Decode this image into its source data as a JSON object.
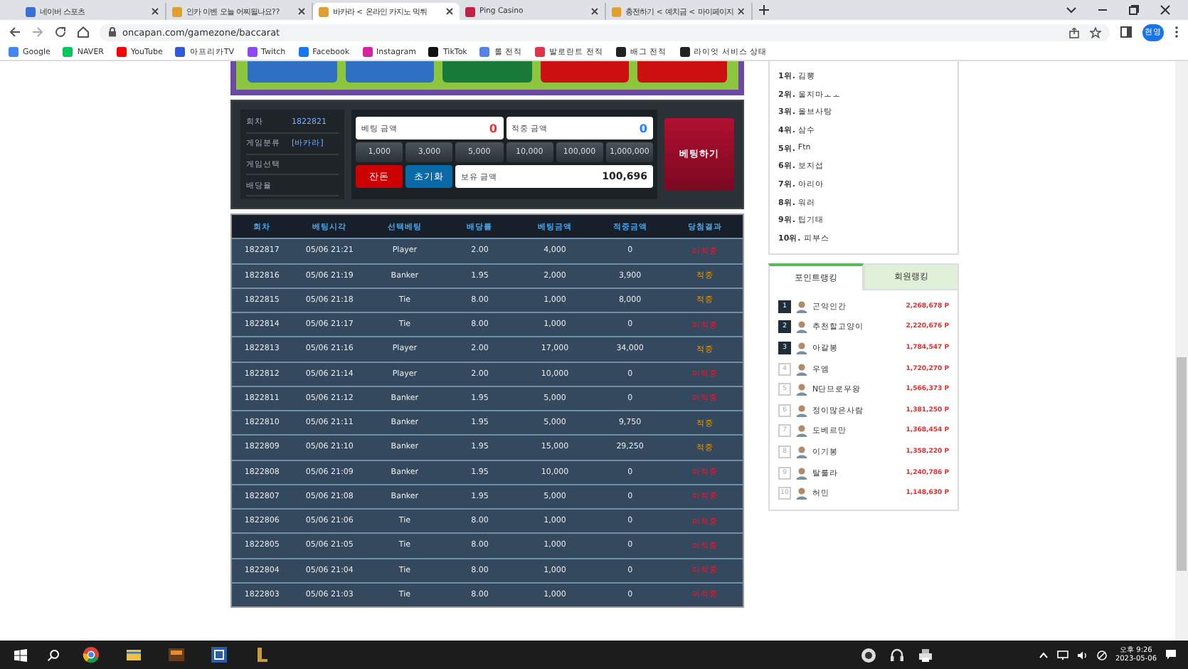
{
  "browser": {
    "tabs": [
      {
        "title": "네이버 스포츠",
        "selected": false,
        "color": "#3b6fd8"
      },
      {
        "title": "인카 이벤 오늘 어찌될나요??",
        "selected": false,
        "color": "#e0a030"
      },
      {
        "title": "바카라 < 온라인 카지노 먹튀",
        "selected": true,
        "color": "#e0a030"
      },
      {
        "title": "Ping Casino",
        "selected": false,
        "color": "#c0224a"
      },
      {
        "title": "충전하기 < 예치금 < 마이페이지",
        "selected": false,
        "color": "#e0a030"
      }
    ],
    "address": "oncapan.com/gamezone/baccarat",
    "profile": "현영",
    "bookmarks": [
      {
        "label": "Google",
        "color": "#4285f4"
      },
      {
        "label": "NAVER",
        "color": "#03c75a"
      },
      {
        "label": "YouTube",
        "color": "#ff0000"
      },
      {
        "label": "아프리카TV",
        "color": "#2f5bd8"
      },
      {
        "label": "Twitch",
        "color": "#9146ff"
      },
      {
        "label": "Facebook",
        "color": "#1877f2"
      },
      {
        "label": "Instagram",
        "color": "#d6249f"
      },
      {
        "label": "TikTok",
        "color": "#111111"
      },
      {
        "label": "롤 전적",
        "color": "#5383e8"
      },
      {
        "label": "발로란트 전적",
        "color": "#e0344a"
      },
      {
        "label": "배그 전적",
        "color": "#222222"
      },
      {
        "label": "라이엇 서비스 상태",
        "color": "#222222"
      }
    ]
  },
  "game_buttons": [
    {
      "color": "#2f6fc4"
    },
    {
      "color": "#2f6fc4"
    },
    {
      "color": "#1a7a3a"
    },
    {
      "color": "#cc1010"
    },
    {
      "color": "#cc1010"
    }
  ],
  "bet_panel": {
    "info": [
      {
        "label": "회차",
        "value": "1822821"
      },
      {
        "label": "게임분류",
        "value": "[바카라]"
      },
      {
        "label": "게임선택"
      },
      {
        "label": "배당율"
      }
    ],
    "bet_amount": {
      "label": "베팅 금액",
      "value": "0"
    },
    "win_amount": {
      "label": "적중 금액",
      "value": "0"
    },
    "chips": [
      "1,000",
      "3,000",
      "5,000",
      "10,000",
      "100,000",
      "1,000,000"
    ],
    "switch_button": "잔돈",
    "reset_button": "초기화",
    "balance": {
      "label": "보유 금액",
      "value": "100,696"
    },
    "bet_button": "베팅하기"
  },
  "history": {
    "columns": [
      "회차",
      "베팅시각",
      "선택베팅",
      "배당률",
      "베팅금액",
      "적중금액",
      "당첨결과"
    ],
    "rows": [
      {
        "cells": [
          "1822817",
          "05/06 21:21",
          "Player",
          "2.00",
          "4,000",
          "0"
        ],
        "result": "미적중",
        "kind": "miss"
      },
      {
        "cells": [
          "1822816",
          "05/06 21:19",
          "Banker",
          "1.95",
          "2,000",
          "3,900"
        ],
        "result": "적중",
        "kind": "hit"
      },
      {
        "cells": [
          "1822815",
          "05/06 21:18",
          "Tie",
          "8.00",
          "1,000",
          "8,000"
        ],
        "result": "적중",
        "kind": "hit"
      },
      {
        "cells": [
          "1822814",
          "05/06 21:17",
          "Tie",
          "8.00",
          "1,000",
          "0"
        ],
        "result": "미적중",
        "kind": "miss"
      },
      {
        "cells": [
          "1822813",
          "05/06 21:16",
          "Player",
          "2.00",
          "17,000",
          "34,000"
        ],
        "result": "적중",
        "kind": "hit"
      },
      {
        "cells": [
          "1822812",
          "05/06 21:14",
          "Player",
          "2.00",
          "10,000",
          "0"
        ],
        "result": "미적중",
        "kind": "miss"
      },
      {
        "cells": [
          "1822811",
          "05/06 21:12",
          "Banker",
          "1.95",
          "5,000",
          "0"
        ],
        "result": "미적중",
        "kind": "miss"
      },
      {
        "cells": [
          "1822810",
          "05/06 21:11",
          "Banker",
          "1.95",
          "5,000",
          "9,750"
        ],
        "result": "적중",
        "kind": "hit"
      },
      {
        "cells": [
          "1822809",
          "05/06 21:10",
          "Banker",
          "1.95",
          "15,000",
          "29,250"
        ],
        "result": "적중",
        "kind": "hit"
      },
      {
        "cells": [
          "1822808",
          "05/06 21:09",
          "Banker",
          "1.95",
          "10,000",
          "0"
        ],
        "result": "미적중",
        "kind": "miss"
      },
      {
        "cells": [
          "1822807",
          "05/06 21:08",
          "Banker",
          "1.95",
          "5,000",
          "0"
        ],
        "result": "미적중",
        "kind": "miss"
      },
      {
        "cells": [
          "1822806",
          "05/06 21:06",
          "Tie",
          "8.00",
          "1,000",
          "0"
        ],
        "result": "미적중",
        "kind": "miss"
      },
      {
        "cells": [
          "1822805",
          "05/06 21:05",
          "Tie",
          "8.00",
          "1,000",
          "0"
        ],
        "result": "미적중",
        "kind": "miss"
      },
      {
        "cells": [
          "1822804",
          "05/06 21:04",
          "Tie",
          "8.00",
          "1,000",
          "0"
        ],
        "result": "미적중",
        "kind": "miss"
      },
      {
        "cells": [
          "1822803",
          "05/06 21:03",
          "Tie",
          "8.00",
          "1,000",
          "0"
        ],
        "result": "미적중",
        "kind": "miss"
      }
    ]
  },
  "top_ranking": [
    {
      "rank": "1위.",
      "name": "김뽕"
    },
    {
      "rank": "2위.",
      "name": "울지마ㅗㅗ"
    },
    {
      "rank": "3위.",
      "name": "올브사탕"
    },
    {
      "rank": "4위.",
      "name": "삼수"
    },
    {
      "rank": "5위.",
      "name": "Ftn"
    },
    {
      "rank": "6위.",
      "name": "보지섭"
    },
    {
      "rank": "7위.",
      "name": "아리아"
    },
    {
      "rank": "8위.",
      "name": "워러"
    },
    {
      "rank": "9위.",
      "name": "팁기태"
    },
    {
      "rank": "10위.",
      "name": "피부스"
    }
  ],
  "ranking_tabs": [
    {
      "label": "포인트랭킹",
      "selected": true
    },
    {
      "label": "회원랭킹",
      "selected": false
    }
  ],
  "point_ranking": [
    {
      "rank": "1",
      "top": true,
      "name": "곤약인간",
      "points": "2,268,678 P"
    },
    {
      "rank": "2",
      "top": true,
      "name": "추천할고양이",
      "points": "2,220,676 P"
    },
    {
      "rank": "3",
      "top": true,
      "name": "아갈봉",
      "points": "1,784,547 P"
    },
    {
      "rank": "4",
      "top": false,
      "name": "우엠",
      "points": "1,720,270 P"
    },
    {
      "rank": "5",
      "top": false,
      "name": "N단므로무왕",
      "points": "1,566,373 P"
    },
    {
      "rank": "6",
      "top": false,
      "name": "정이많은사람",
      "points": "1,381,250 P"
    },
    {
      "rank": "7",
      "top": false,
      "name": "도베르만",
      "points": "1,368,454 P"
    },
    {
      "rank": "8",
      "top": false,
      "name": "이기봉",
      "points": "1,358,220 P"
    },
    {
      "rank": "9",
      "top": false,
      "name": "탈룰라",
      "points": "1,240,786 P"
    },
    {
      "rank": "10",
      "top": false,
      "name": "허민",
      "points": "1,148,630 P"
    }
  ],
  "taskbar": {
    "time": "오후 9:26",
    "date": "2023-05-06"
  }
}
